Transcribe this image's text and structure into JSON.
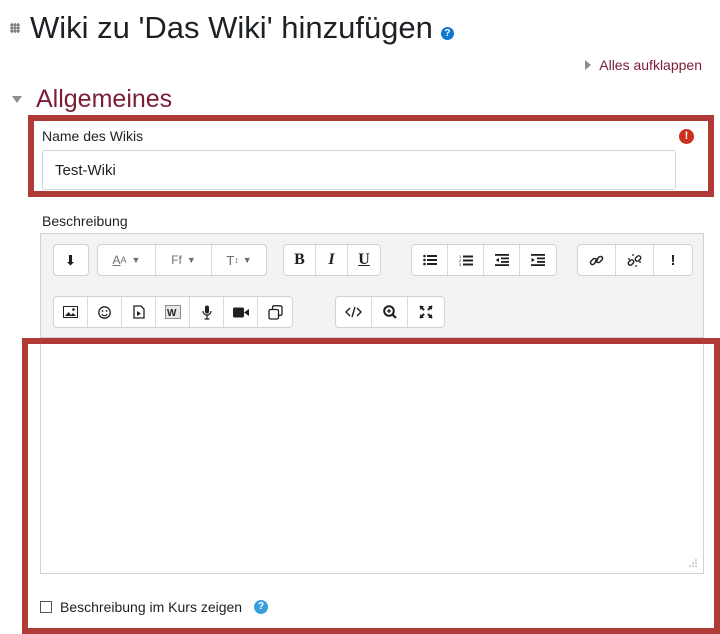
{
  "header": {
    "title": "Wiki zu 'Das Wiki' hinzufügen",
    "title_icon": "wiki-activity-icon",
    "help_icon": "question-circle-icon"
  },
  "expand_all": {
    "label": "Alles aufklappen"
  },
  "section": {
    "title": "Allgemeines"
  },
  "name_field": {
    "label": "Name des Wikis",
    "value": "Test-Wiki",
    "required_icon": "exclamation-circle-icon"
  },
  "description": {
    "label": "Beschreibung",
    "toolbar": {
      "row1": [
        [
          "collapse-icon"
        ],
        [
          "font-color-icon",
          "font-family-icon",
          "font-size-icon"
        ],
        [
          "bold-icon",
          "italic-icon",
          "underline-icon"
        ],
        [
          "unordered-list-icon",
          "ordered-list-icon",
          "outdent-icon",
          "indent-icon"
        ],
        [
          "link-icon",
          "unlink-icon",
          "accessibility-checker-icon"
        ]
      ],
      "row2": [
        [
          "image-icon",
          "emoticon-icon",
          "media-icon",
          "word-import-icon",
          "record-audio-icon",
          "record-video-icon",
          "manage-files-icon"
        ],
        [
          "html-icon",
          "zoom-icon",
          "fullscreen-icon"
        ]
      ],
      "labels": {
        "bold": "B",
        "italic": "I",
        "underline": "U",
        "accessibility": "!",
        "font_color": "A",
        "font_family": "Ff",
        "font_size": "T"
      }
    },
    "editor_content": ""
  },
  "show_in_course": {
    "label": "Beschreibung im Kurs zeigen",
    "checked": false
  },
  "colors": {
    "accent": "#7a1d35",
    "highlight_border": "#b03a36",
    "required": "#ca3120",
    "help": "#3aa0dd"
  }
}
